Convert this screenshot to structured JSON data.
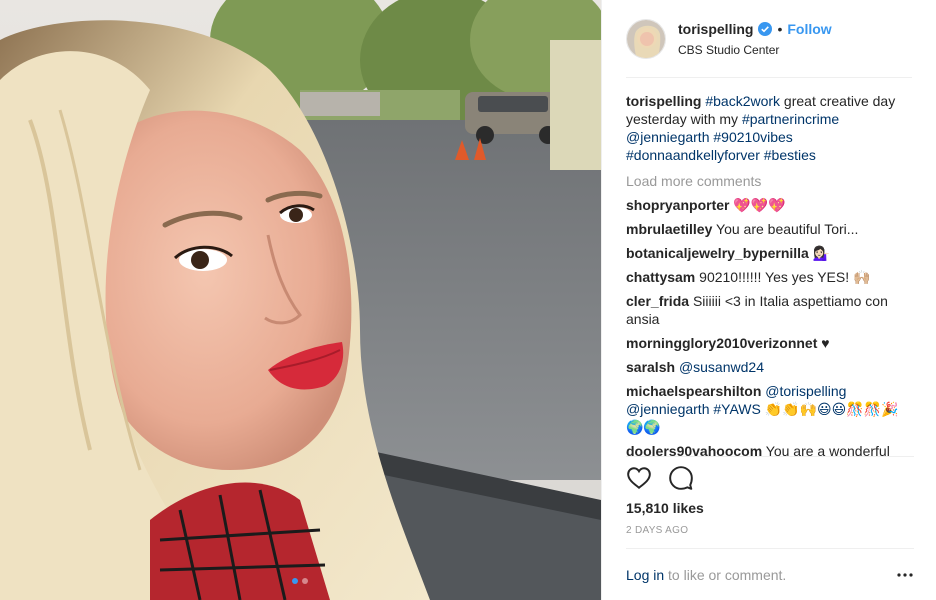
{
  "header": {
    "username": "torispelling",
    "separator": "•",
    "follow_label": "Follow",
    "location": "CBS Studio Center"
  },
  "caption": {
    "username": "torispelling",
    "parts": [
      "#back2work",
      " great creative day yesterday with my ",
      "#partnerincrime",
      " ",
      "@jenniegarth",
      " ",
      "#90210vibes",
      " ",
      "#donnaandkellyforver",
      " ",
      "#besties"
    ]
  },
  "load_more_label": "Load more comments",
  "comments": [
    {
      "user": "shopryanporter",
      "text": "💖💖💖"
    },
    {
      "user": "mbrulaetilley",
      "text": "You are beautiful Tori..."
    },
    {
      "user": "botanicaljewelry_bypernilla",
      "text": "💁🏻‍♀️"
    },
    {
      "user": "chattysam",
      "text": "90210!!!!!! Yes yes YES! 🙌🏼"
    },
    {
      "user": "cler_frida",
      "text": "Siiiiii <3 in Italia aspettiamo con ansia"
    },
    {
      "user": "morningglory2010verizonnet",
      "text": "♥"
    },
    {
      "user": "saralsh",
      "text": "@susanwd24"
    },
    {
      "user": "michaelspearshilton",
      "text": "@torispelling @jenniegarth #YAWS 👏👏🙌😃😃🎊🎊🎉🌍🌍"
    },
    {
      "user": "doolers90vahoocom",
      "text": "You are a wonderful"
    }
  ],
  "icons": {
    "like": "heart-outline-icon",
    "comment": "speech-bubble-icon",
    "verified": "verified-badge-icon",
    "more": "more-options-icon"
  },
  "likes_label": "15,810 likes",
  "timestamp": "2 DAYS AGO",
  "footer": {
    "login_label": "Log in",
    "rest_text": " to like or comment.",
    "more_label": "•••"
  },
  "colors": {
    "link_blue": "#3897f0",
    "hashtag": "#003569",
    "muted": "#999999",
    "border": "#efefef"
  },
  "carousel": {
    "count": 2,
    "active": 1
  }
}
